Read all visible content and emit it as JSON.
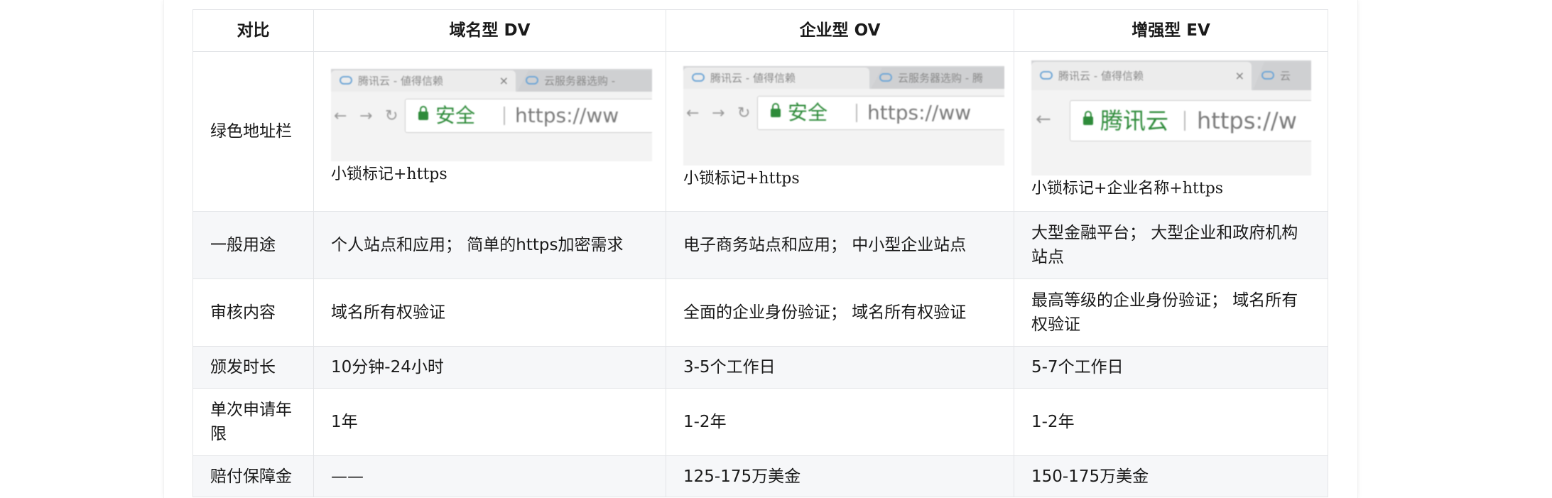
{
  "table": {
    "headers": [
      "对比",
      "域名型 DV",
      "企业型 OV",
      "增强型 EV"
    ],
    "address_bar": {
      "label": "绿色地址栏",
      "items": [
        {
          "tab1": "腾讯云 - 値得信赖",
          "tab2": "云服务器选购 -",
          "badge": "安全",
          "url": "https://ww",
          "caption": "小锁标记+https"
        },
        {
          "tab1": "腾讯云 - 値得信赖",
          "tab2": "云服务器选购 - 腾",
          "badge": "安全",
          "url": "https://ww",
          "caption": "小锁标记+https"
        },
        {
          "tab1": "腾讯云 - 値得信赖",
          "tab2": "云",
          "badge": "腾讯云",
          "url": "https://w",
          "caption": "小锁标记+企业名称+https"
        }
      ]
    },
    "rows": [
      {
        "label": "一般用途",
        "values": [
          "个人站点和应用； 简单的https加密需求",
          "电子商务站点和应用； 中小型企业站点",
          "大型金融平台； 大型企业和政府机构站点"
        ]
      },
      {
        "label": "审核内容",
        "values": [
          "域名所有权验证",
          "全面的企业身份验证； 域名所有权验证",
          "最高等级的企业身份验证； 域名所有权验证"
        ]
      },
      {
        "label": "颁发时长",
        "values": [
          "10分钟-24小时",
          "3-5个工作日",
          "5-7个工作日"
        ]
      },
      {
        "label": "单次申请年限",
        "values": [
          "1年",
          "1-2年",
          "1-2年"
        ]
      },
      {
        "label": "赔付保障金",
        "values": [
          "——",
          "125-175万美金",
          "150-175万美金"
        ]
      }
    ]
  },
  "colors": {
    "border": "#e3e5e8",
    "alt_row": "#f6f7f9",
    "secure_green": "#2e8b3a"
  }
}
